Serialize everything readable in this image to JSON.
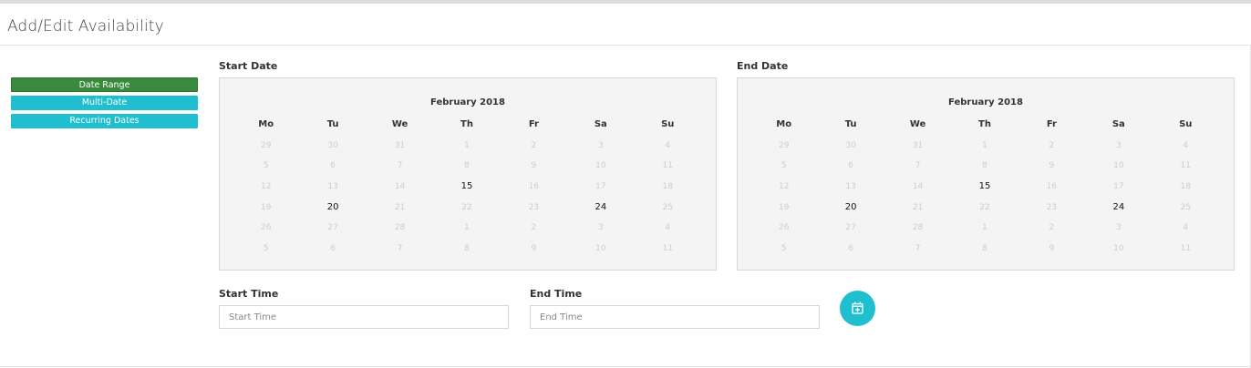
{
  "header": {
    "title": "Add/Edit Availability"
  },
  "modes": [
    {
      "label": "Date Range",
      "active": true
    },
    {
      "label": "Multi-Date",
      "active": false
    },
    {
      "label": "Recurring Dates",
      "active": false
    }
  ],
  "start_date": {
    "label": "Start Date",
    "month": "February 2018",
    "weekdays": [
      "Mo",
      "Tu",
      "We",
      "Th",
      "Fr",
      "Sa",
      "Su"
    ],
    "weeks": [
      [
        "29",
        "30",
        "31",
        "1",
        "2",
        "3",
        "4"
      ],
      [
        "5",
        "6",
        "7",
        "8",
        "9",
        "10",
        "11"
      ],
      [
        "12",
        "13",
        "14",
        "15",
        "16",
        "17",
        "18"
      ],
      [
        "19",
        "20",
        "21",
        "22",
        "23",
        "24",
        "25"
      ],
      [
        "26",
        "27",
        "28",
        "1",
        "2",
        "3",
        "4"
      ],
      [
        "5",
        "6",
        "7",
        "8",
        "9",
        "10",
        "11"
      ]
    ],
    "available_days": [
      "15",
      "20",
      "24"
    ]
  },
  "end_date": {
    "label": "End Date",
    "month": "February 2018",
    "weekdays": [
      "Mo",
      "Tu",
      "We",
      "Th",
      "Fr",
      "Sa",
      "Su"
    ],
    "weeks": [
      [
        "29",
        "30",
        "31",
        "1",
        "2",
        "3",
        "4"
      ],
      [
        "5",
        "6",
        "7",
        "8",
        "9",
        "10",
        "11"
      ],
      [
        "12",
        "13",
        "14",
        "15",
        "16",
        "17",
        "18"
      ],
      [
        "19",
        "20",
        "21",
        "22",
        "23",
        "24",
        "25"
      ],
      [
        "26",
        "27",
        "28",
        "1",
        "2",
        "3",
        "4"
      ],
      [
        "5",
        "6",
        "7",
        "8",
        "9",
        "10",
        "11"
      ]
    ],
    "available_days": [
      "15",
      "20",
      "24"
    ]
  },
  "start_time": {
    "label": "Start Time",
    "placeholder": "Start Time",
    "value": ""
  },
  "end_time": {
    "label": "End Time",
    "placeholder": "End Time",
    "value": ""
  },
  "add_button": {
    "icon": "calendar-plus-icon"
  },
  "colors": {
    "accent": "#1fbfcf",
    "active_mode": "#3a8a3d",
    "calendar_bg": "#f4f4f4"
  }
}
